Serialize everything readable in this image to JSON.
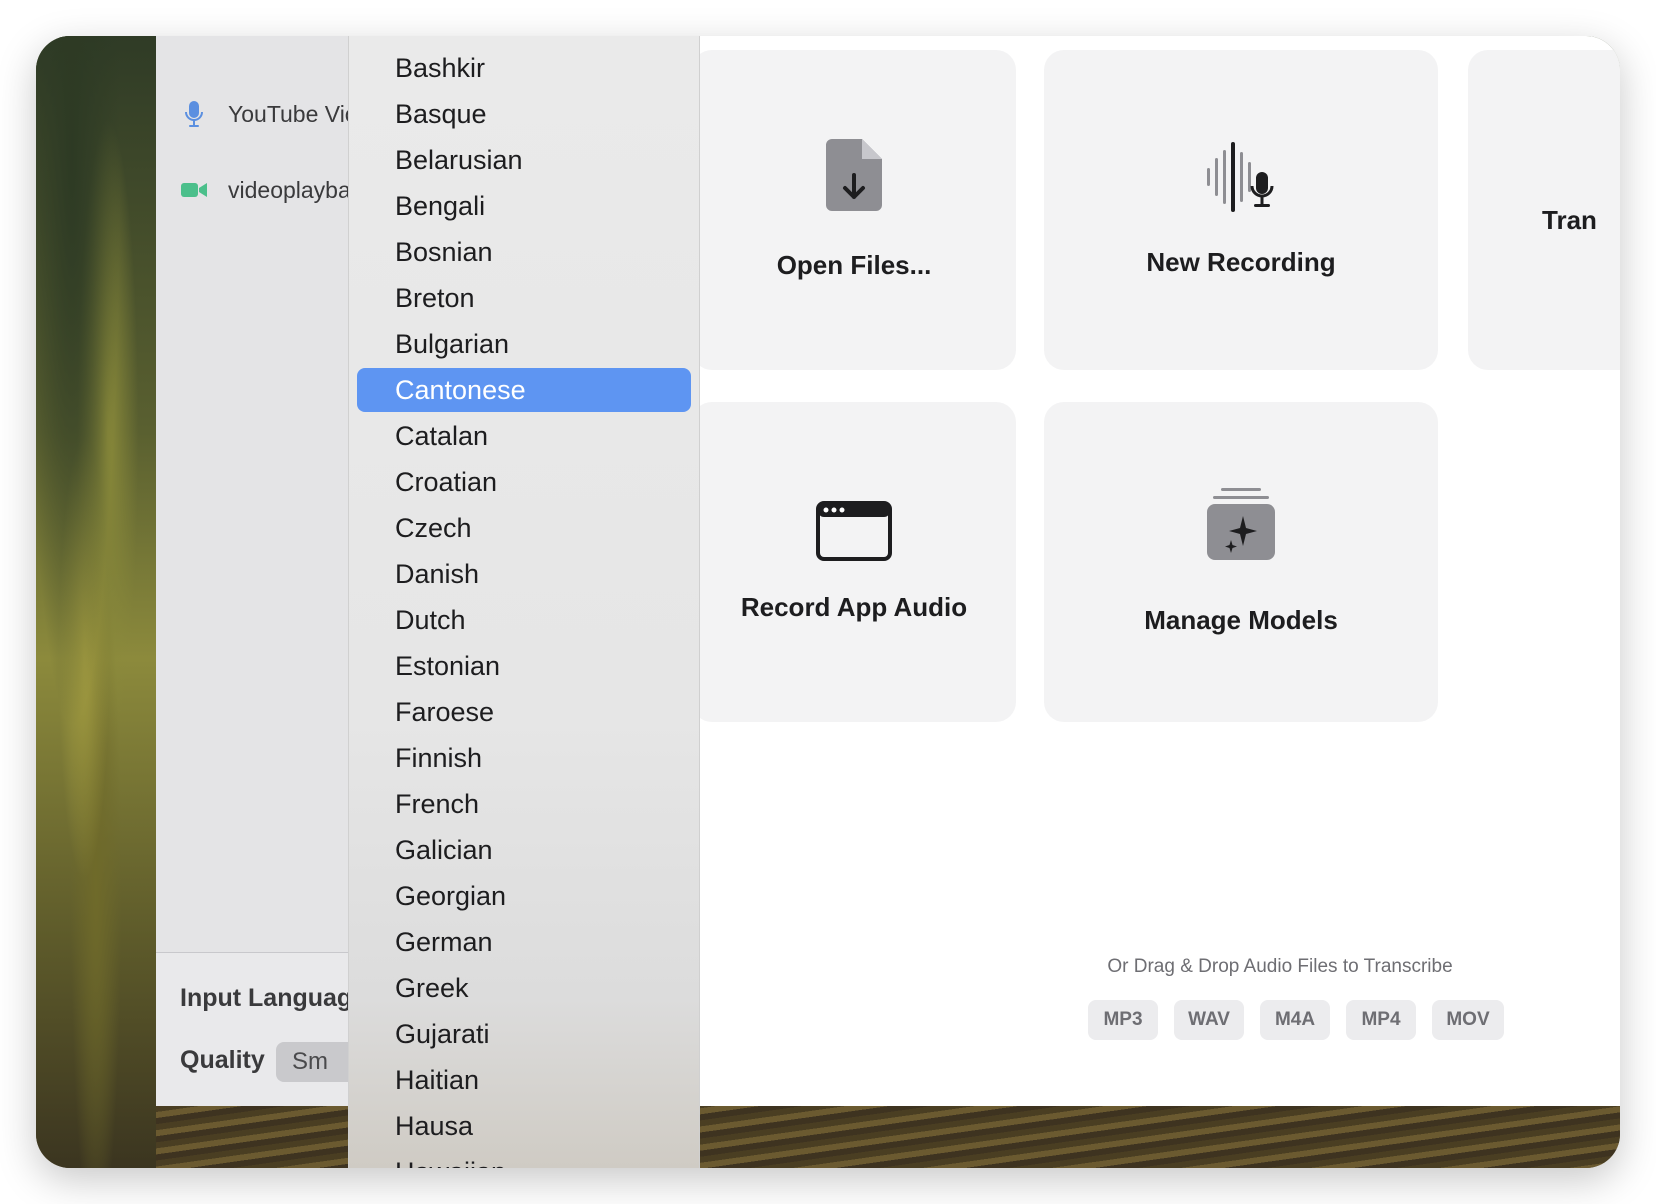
{
  "sidebar": {
    "items": [
      {
        "label": "YouTube Vic",
        "icon": "microphone-icon"
      },
      {
        "label": "videoplayba",
        "icon": "video-camera-icon"
      }
    ],
    "input_language_label": "Input Languag",
    "quality_label": "Quality",
    "quality_value": "Sm"
  },
  "language_menu": {
    "items": [
      "Bashkir",
      "Basque",
      "Belarusian",
      "Bengali",
      "Bosnian",
      "Breton",
      "Bulgarian",
      "Cantonese",
      "Catalan",
      "Croatian",
      "Czech",
      "Danish",
      "Dutch",
      "Estonian",
      "Faroese",
      "Finnish",
      "French",
      "Galician",
      "Georgian",
      "German",
      "Greek",
      "Gujarati",
      "Haitian",
      "Hausa",
      "Hawaiian"
    ],
    "selected": "Cantonese"
  },
  "cards": {
    "open_files": {
      "label": "Open Files...",
      "icon": "document-download-icon"
    },
    "new_recording": {
      "label": "New Recording",
      "icon": "waveform-microphone-icon"
    },
    "transcribe_partial": {
      "label": "Tran"
    },
    "record_app_audio": {
      "label": "Record App Audio",
      "icon": "app-window-icon"
    },
    "manage_models": {
      "label": "Manage Models",
      "icon": "sparkle-stack-icon"
    }
  },
  "drop_zone": {
    "text": "Or Drag & Drop Audio Files to Transcribe",
    "formats": [
      "MP3",
      "WAV",
      "M4A",
      "MP4",
      "MOV"
    ]
  },
  "colors": {
    "selection": "#5e95f2",
    "card_bg": "#f3f3f4",
    "mic_icon": "#5b8fe0",
    "video_icon": "#4bbf8b"
  }
}
